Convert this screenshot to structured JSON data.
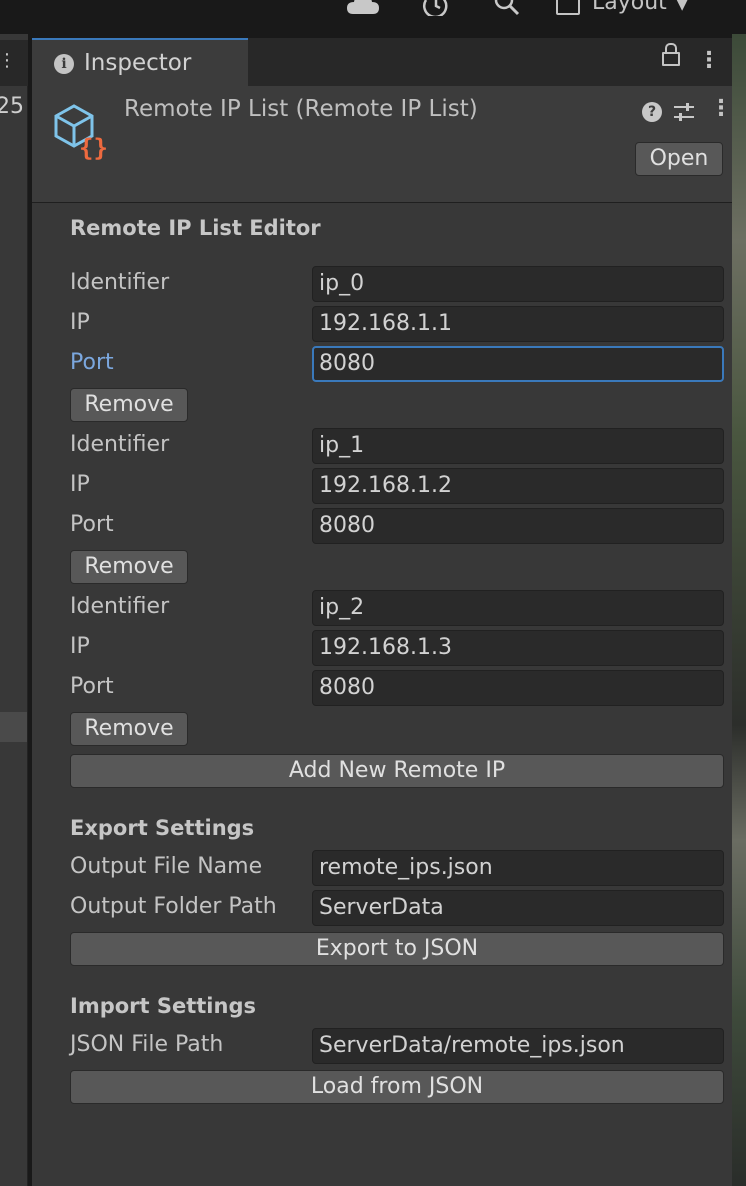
{
  "topbar": {
    "cloud_icon": "cloud-icon",
    "history_icon": "history-icon",
    "search_icon": "search-icon",
    "layout_label": "Layout",
    "layout_icon": "layout-icon"
  },
  "left_panel": {
    "number_fragment": "25"
  },
  "inspector": {
    "tab_label": "Inspector",
    "object_title": "Remote IP List (Remote IP List)",
    "open_label": "Open",
    "editor_title": "Remote IP List Editor",
    "entries": [
      {
        "identifier_label": "Identifier",
        "identifier": "ip_0",
        "ip_label": "IP",
        "ip": "192.168.1.1",
        "port_label": "Port",
        "port": "8080",
        "remove_label": "Remove"
      },
      {
        "identifier_label": "Identifier",
        "identifier": "ip_1",
        "ip_label": "IP",
        "ip": "192.168.1.2",
        "port_label": "Port",
        "port": "8080",
        "remove_label": "Remove"
      },
      {
        "identifier_label": "Identifier",
        "identifier": "ip_2",
        "ip_label": "IP",
        "ip": "192.168.1.3",
        "port_label": "Port",
        "port": "8080",
        "remove_label": "Remove"
      }
    ],
    "add_label": "Add New Remote IP",
    "export": {
      "title": "Export Settings",
      "file_name_label": "Output File Name",
      "file_name": "remote_ips.json",
      "folder_label": "Output Folder Path",
      "folder": "ServerData",
      "button_label": "Export to JSON"
    },
    "import": {
      "title": "Import Settings",
      "path_label": "JSON File Path",
      "path": "ServerData/remote_ips.json",
      "button_label": "Load from JSON"
    }
  },
  "colors": {
    "focus_accent": "#3a79bb",
    "focused_label": "#7ba7de",
    "panel_bg": "#383838",
    "field_bg": "#2a2a2a"
  }
}
